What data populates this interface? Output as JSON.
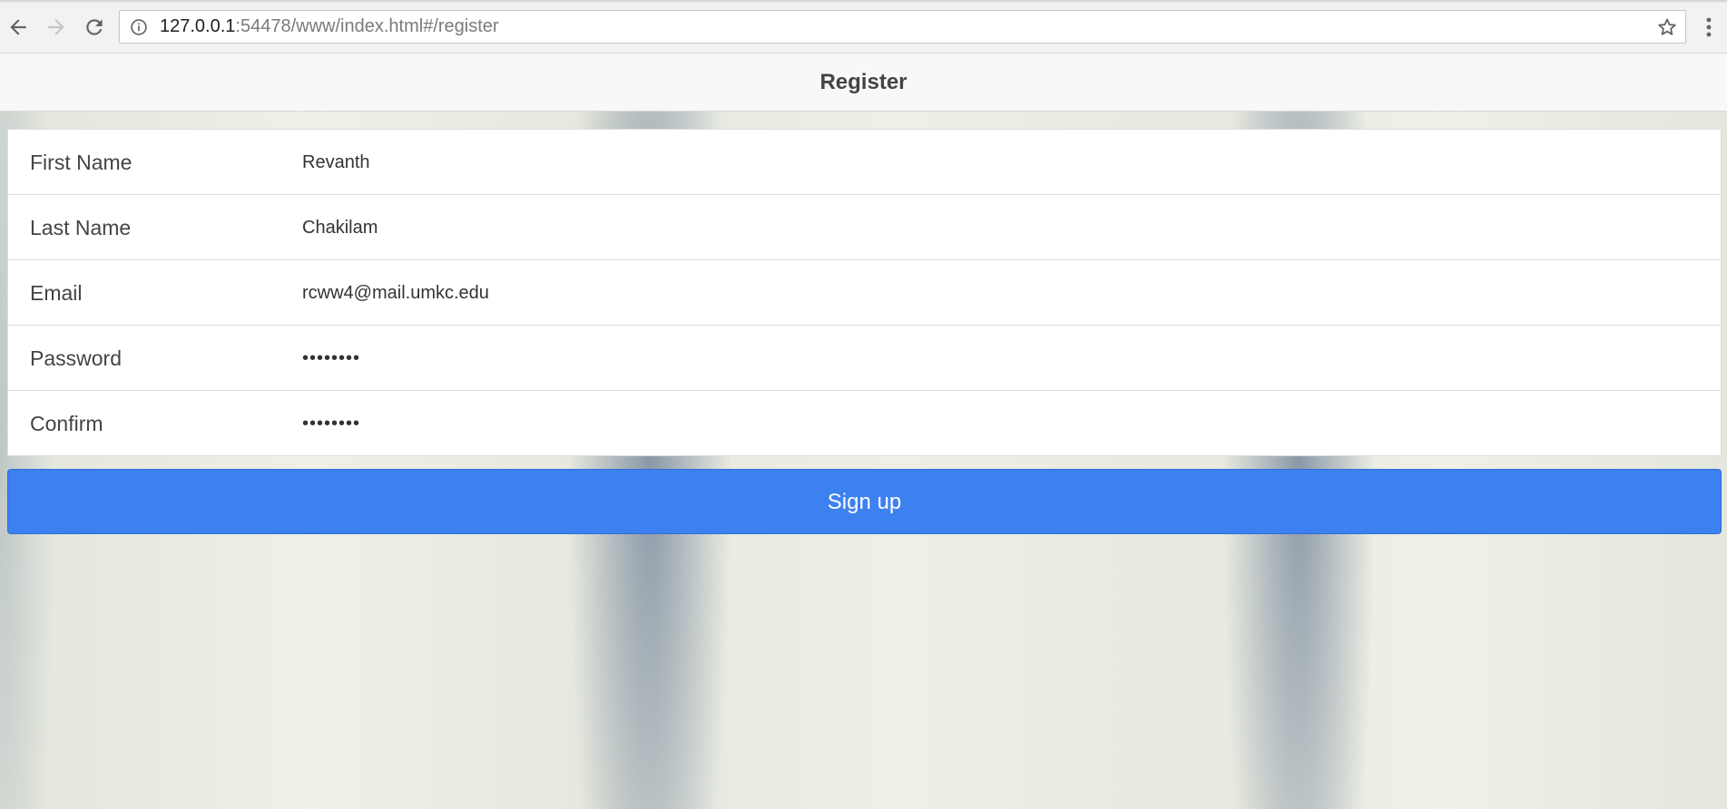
{
  "browser": {
    "url_host": "127.0.0.1",
    "url_rest": ":54478/www/index.html#/register",
    "icons": {
      "back": "back-arrow-icon",
      "forward": "forward-arrow-icon",
      "reload": "reload-icon",
      "info": "info-icon",
      "bookmark": "star-icon",
      "menu": "kebab-menu-icon"
    }
  },
  "header": {
    "title": "Register"
  },
  "form": {
    "fields": [
      {
        "label": "First Name",
        "value": "Revanth",
        "type": "text"
      },
      {
        "label": "Last Name",
        "value": "Chakilam",
        "type": "text"
      },
      {
        "label": "Email",
        "value": "rcww4@mail.umkc.edu",
        "type": "email"
      },
      {
        "label": "Password",
        "value": "........",
        "type": "password"
      },
      {
        "label": "Confirm",
        "value": "........",
        "type": "password"
      }
    ],
    "submit_label": "Sign up"
  },
  "colors": {
    "primary_button": "#3d81f0",
    "navbar_bg": "#f8f8f8",
    "text": "#444444"
  }
}
